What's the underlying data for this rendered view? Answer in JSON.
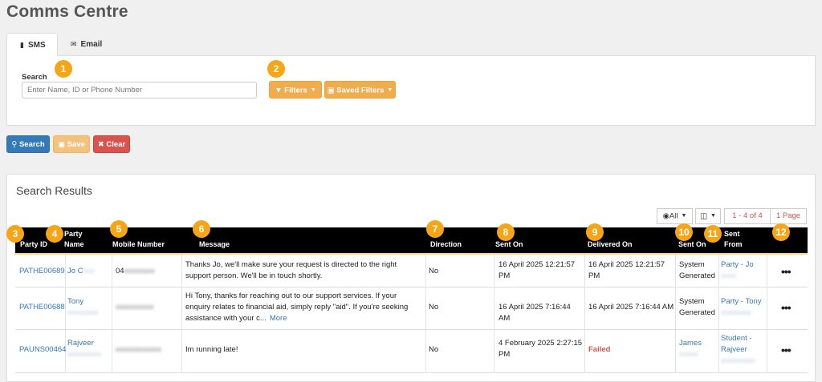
{
  "page_title": "Comms Centre",
  "tabs": [
    {
      "label": "SMS",
      "icon": "chat-bubble-icon"
    },
    {
      "label": "Email",
      "icon": "envelope-icon"
    }
  ],
  "search": {
    "label": "Search",
    "placeholder": "Enter Name, ID or Phone Number",
    "filters_label": "Filters",
    "saved_filters_label": "Saved Filters"
  },
  "actions": {
    "search_label": "Search",
    "save_label": "Save",
    "clear_label": "Clear"
  },
  "results": {
    "title": "Search Results",
    "view_all_label": "All",
    "pagination_range": "1 - 4 of 4",
    "pagination_pages": "1 Page"
  },
  "columns": [
    {
      "label": "Party ID"
    },
    {
      "label": "Party Name"
    },
    {
      "label": "Mobile Number"
    },
    {
      "label": "Message"
    },
    {
      "label": "Direction"
    },
    {
      "label": "Sent On"
    },
    {
      "label": "Delivered On"
    },
    {
      "label": "Sent On"
    },
    {
      "label": "Sent From"
    }
  ],
  "rows": [
    {
      "party_id": "PATHE00689",
      "party_name": "Jo C",
      "party_name_hidden": "xxx",
      "mobile": "04",
      "mobile_hidden": "xxxxxxxx",
      "message": "Thanks Jo, we'll make sure your request is directed to the right support person. We'll be in touch shortly.",
      "direction": "No",
      "sent_on": "16 April 2025 12:21:57 PM",
      "delivered_on": "16 April 2025 12:21:57 PM",
      "sent_on_source": "System Generated",
      "sent_from": "Party - Jo",
      "sent_from_hidden": "xxxx"
    },
    {
      "party_id": "PATHE00688",
      "party_name": "Tony",
      "party_name_hidden": "xxxxxxxx",
      "mobile": "",
      "mobile_hidden": "xxxxxxxxxx",
      "message": "Hi Tony, thanks for reaching out to our support services. If your enquiry relates to financial aid, simply reply \"aid\". If you're seeking assistance with your c...",
      "more_label": "More",
      "direction": "No",
      "sent_on": "16 April 2025 7:16:44 AM",
      "delivered_on": "16 April 2025 7:16:44 AM",
      "sent_on_source": "System Generated",
      "sent_from": "Party - Tony",
      "sent_from_hidden": "xxxxxxxx"
    },
    {
      "party_id": "PAUNS00464",
      "party_name": "Rajveer",
      "party_name_hidden": "xxxxxxxxx",
      "mobile": "",
      "mobile_hidden": "xxxxxxxxxxxx",
      "message": "Im running late!",
      "direction": "No",
      "sent_on": "4 February 2025 2:27:15 PM",
      "delivered_on": "Failed",
      "sent_on_source": "James",
      "sent_on_source_hidden": "xxxxx",
      "sent_from": "Student - Rajveer",
      "sent_from_hidden": "xxxxxxxxx"
    }
  ],
  "badges": [
    "1",
    "2",
    "3",
    "4",
    "5",
    "6",
    "7",
    "8",
    "9",
    "10",
    "11",
    "12"
  ],
  "colors": {
    "accent_orange": "#f0ad4e",
    "primary_blue": "#337ab7",
    "danger_red": "#d9534f",
    "badge_orange": "#f5a516",
    "header_black": "#000000"
  }
}
